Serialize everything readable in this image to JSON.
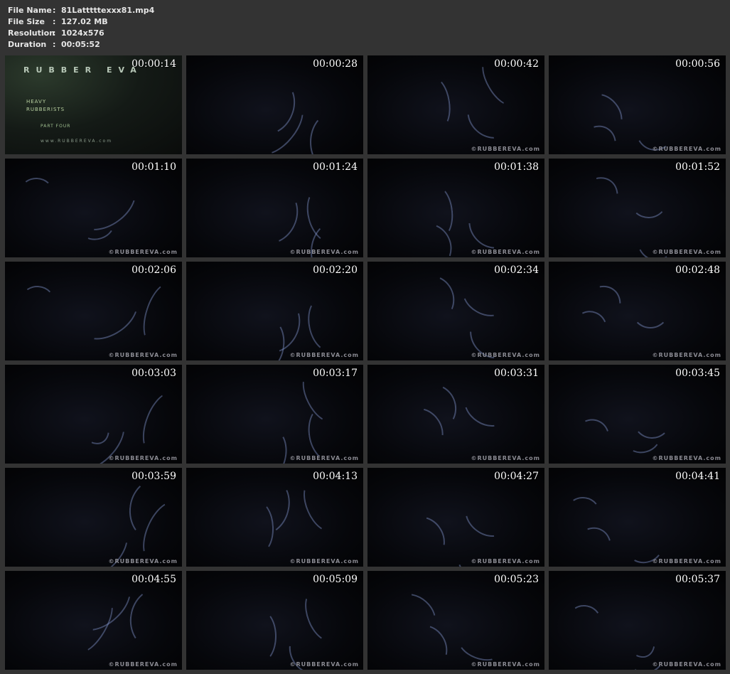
{
  "info": [
    {
      "key": "File Name",
      "value": "81Latttttexxx81.mp4"
    },
    {
      "key": "File Size",
      "value": "127.02 MB"
    },
    {
      "key": "Resolution",
      "value": "1024x576"
    },
    {
      "key": "Duration",
      "value": "00:05:52"
    }
  ],
  "title_card": {
    "brand": "RUBBER EVA",
    "line1": "HEAVY",
    "line2": "RUBBERISTS",
    "part": "PART FOUR",
    "url": "www.RUBBEREVA.com"
  },
  "watermark": "©RUBBEREVA.com",
  "thumbnails": [
    "00:00:14",
    "00:00:28",
    "00:00:42",
    "00:00:56",
    "00:01:10",
    "00:01:24",
    "00:01:38",
    "00:01:52",
    "00:02:06",
    "00:02:20",
    "00:02:34",
    "00:02:48",
    "00:03:03",
    "00:03:17",
    "00:03:31",
    "00:03:45",
    "00:03:59",
    "00:04:13",
    "00:04:27",
    "00:04:41",
    "00:04:55",
    "00:05:09",
    "00:05:23",
    "00:05:37"
  ]
}
